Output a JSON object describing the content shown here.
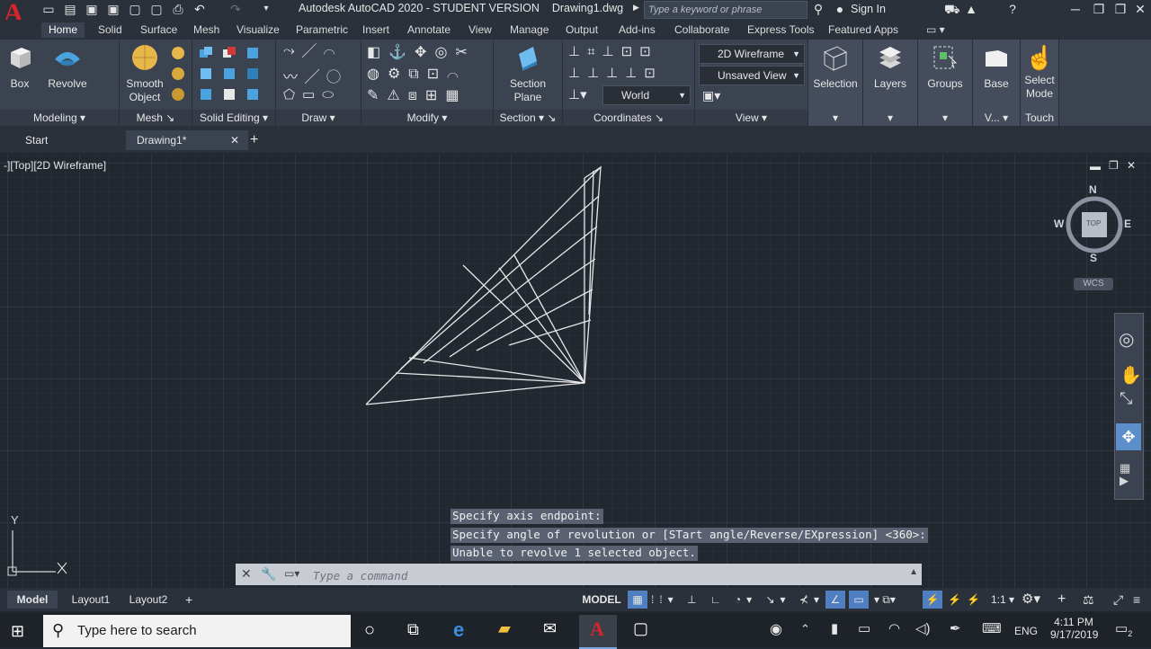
{
  "window": {
    "title": "Autodesk AutoCAD 2020 - STUDENT VERSION",
    "filename": "Drawing1.dwg",
    "search_placeholder": "Type a keyword or phrase",
    "sign_in": "Sign In",
    "logo_letter": "A"
  },
  "ribbon_tabs": [
    "Home",
    "Solid",
    "Surface",
    "Mesh",
    "Visualize",
    "Parametric",
    "Insert",
    "Annotate",
    "View",
    "Manage",
    "Output",
    "Add-ins",
    "Collaborate",
    "Express Tools",
    "Featured Apps"
  ],
  "panels": {
    "modeling": {
      "title": "Modeling",
      "box": "Box",
      "revolve": "Revolve"
    },
    "mesh": {
      "title": "Mesh",
      "smooth_object_1": "Smooth",
      "smooth_object_2": "Object"
    },
    "solid_editing": {
      "title": "Solid Editing"
    },
    "draw": {
      "title": "Draw"
    },
    "modify": {
      "title": "Modify"
    },
    "section": {
      "title": "Section",
      "section_plane_1": "Section",
      "section_plane_2": "Plane"
    },
    "coordinates": {
      "title": "Coordinates",
      "ucs": "World"
    },
    "view": {
      "title": "View",
      "visual_style": "2D Wireframe",
      "named_view": "Unsaved View"
    },
    "selection": {
      "label": "Selection"
    },
    "layers": {
      "label": "Layers"
    },
    "groups": {
      "label": "Groups"
    },
    "base": {
      "label": "Base",
      "footer": "V..."
    },
    "select_mode": {
      "label_1": "Select",
      "label_2": "Mode",
      "footer": "Touch"
    }
  },
  "doc_tabs": {
    "start": "Start",
    "drawing": "Drawing1*"
  },
  "viewport": {
    "label": "-][Top][2D Wireframe]",
    "viewcube": {
      "n": "N",
      "s": "S",
      "e": "E",
      "w": "W",
      "face": "TOP",
      "wcs": "WCS"
    },
    "ucs_y": "Y"
  },
  "command_history": [
    "Specify axis endpoint:",
    "Specify angle of revolution or [STart angle/Reverse/EXpression] <360>:",
    "Unable to revolve 1 selected object."
  ],
  "command_placeholder": "Type a command",
  "layout_tabs": [
    "Model",
    "Layout1",
    "Layout2"
  ],
  "status": {
    "model": "MODEL",
    "scale": "1:1"
  },
  "taskbar": {
    "search_placeholder": "Type here to search",
    "lang": "ENG",
    "time": "4:11 PM",
    "date": "9/17/2019",
    "notifications": "2"
  },
  "colors": {
    "accent": "#d7262b",
    "ribbon": "#3b4250",
    "viewport": "#212830",
    "taskbar": "#1e2329"
  }
}
